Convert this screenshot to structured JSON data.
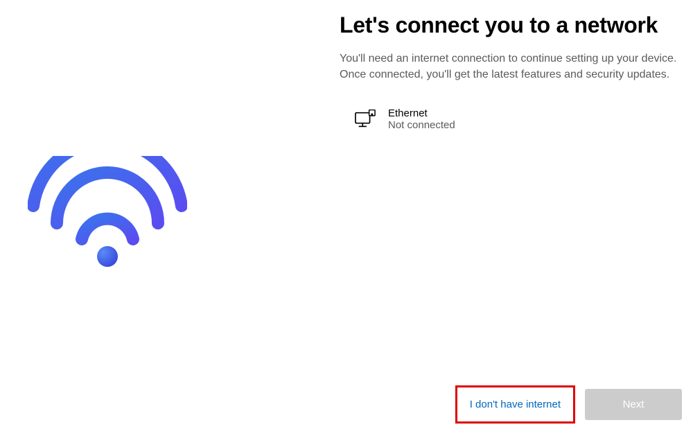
{
  "setup": {
    "title": "Let's connect you to a network",
    "description": "You'll need an internet connection to continue setting up your device. Once connected, you'll get the latest features and security updates."
  },
  "network": {
    "name": "Ethernet",
    "status": "Not connected"
  },
  "buttons": {
    "skip": "I don't have internet",
    "next": "Next"
  }
}
